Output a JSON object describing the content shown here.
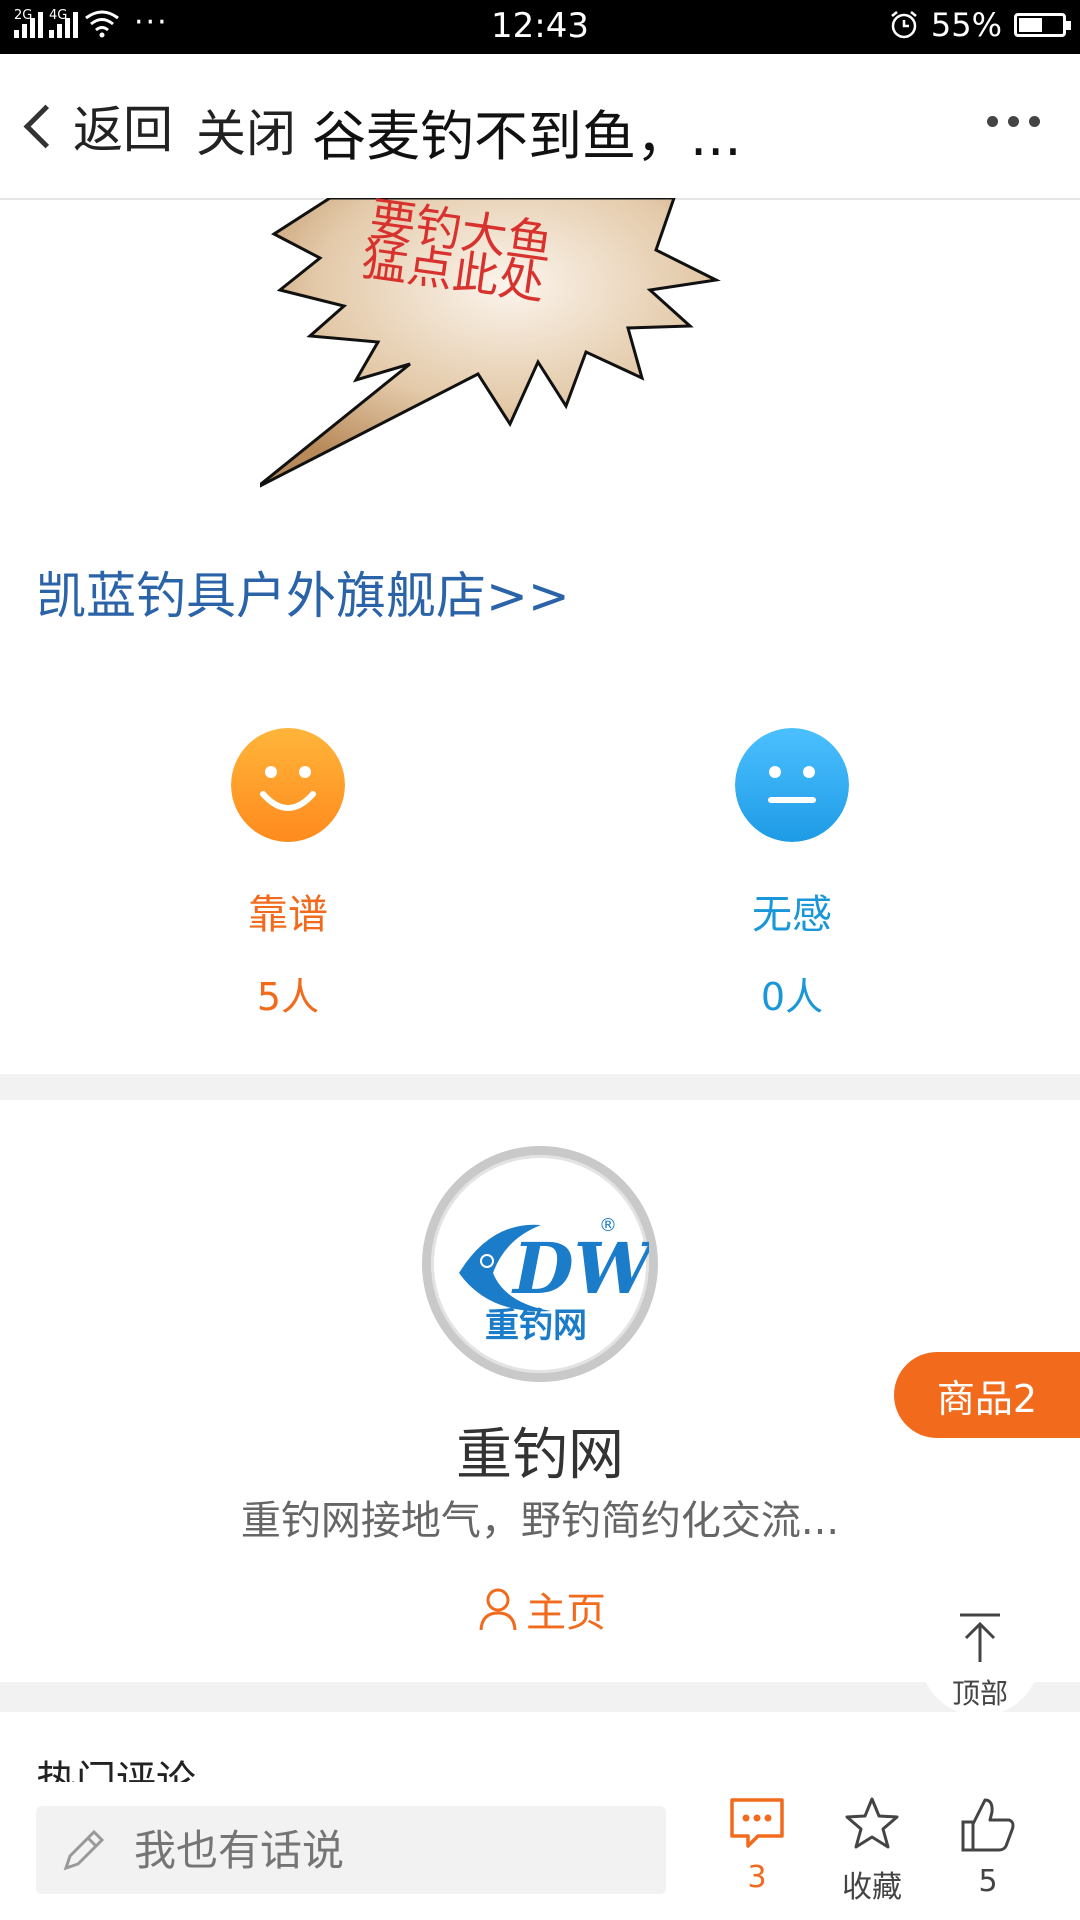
{
  "status_bar": {
    "network1": "2G",
    "network2": "4G",
    "more": "···",
    "time": "12:43",
    "battery_percent": "55%",
    "battery_level": 0.55
  },
  "nav": {
    "back_label": "返回",
    "close_label": "关闭",
    "title": "谷麦钓不到鱼，..."
  },
  "banner": {
    "text_line1": "要钓大鱼",
    "text_line2": "猛点此处"
  },
  "shop_link": "凯蓝钓具户外旗舰店>>",
  "reactions": [
    {
      "label": "靠谱",
      "count": "5人",
      "color": "#f26b1d"
    },
    {
      "label": "无感",
      "count": "0人",
      "color": "#1a97d9"
    }
  ],
  "author": {
    "logo_text": "DW",
    "logo_caption": "重钓网",
    "logo_registered": "®",
    "name": "重钓网",
    "description": "重钓网接地气，野钓简约化交流...",
    "homepage_label": "主页"
  },
  "floating": {
    "goods_label": "商品2",
    "top_label": "顶部"
  },
  "comments": {
    "section_title": "热门评论"
  },
  "bottom_bar": {
    "input_placeholder": "我也有话说",
    "comment_count": "3",
    "favorite_label": "收藏",
    "like_count": "5"
  },
  "colors": {
    "accent_orange": "#f26b1d",
    "accent_blue": "#1a97d9",
    "link_blue": "#2b63a8"
  }
}
